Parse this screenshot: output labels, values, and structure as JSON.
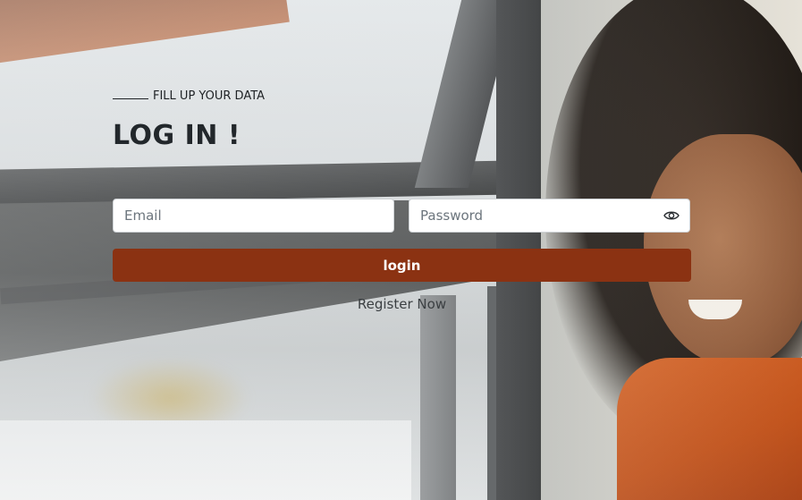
{
  "form": {
    "eyebrow": "FILL UP YOUR DATA",
    "title": "LOG IN !",
    "email_placeholder": "Email",
    "email_value": "",
    "password_placeholder": "Password",
    "password_value": "",
    "password_toggle_icon": "eye-icon",
    "login_label": "login",
    "register_label": "Register Now"
  },
  "colors": {
    "accent": "#8b3212",
    "heading": "#22272b",
    "link": "#3b3f42"
  }
}
